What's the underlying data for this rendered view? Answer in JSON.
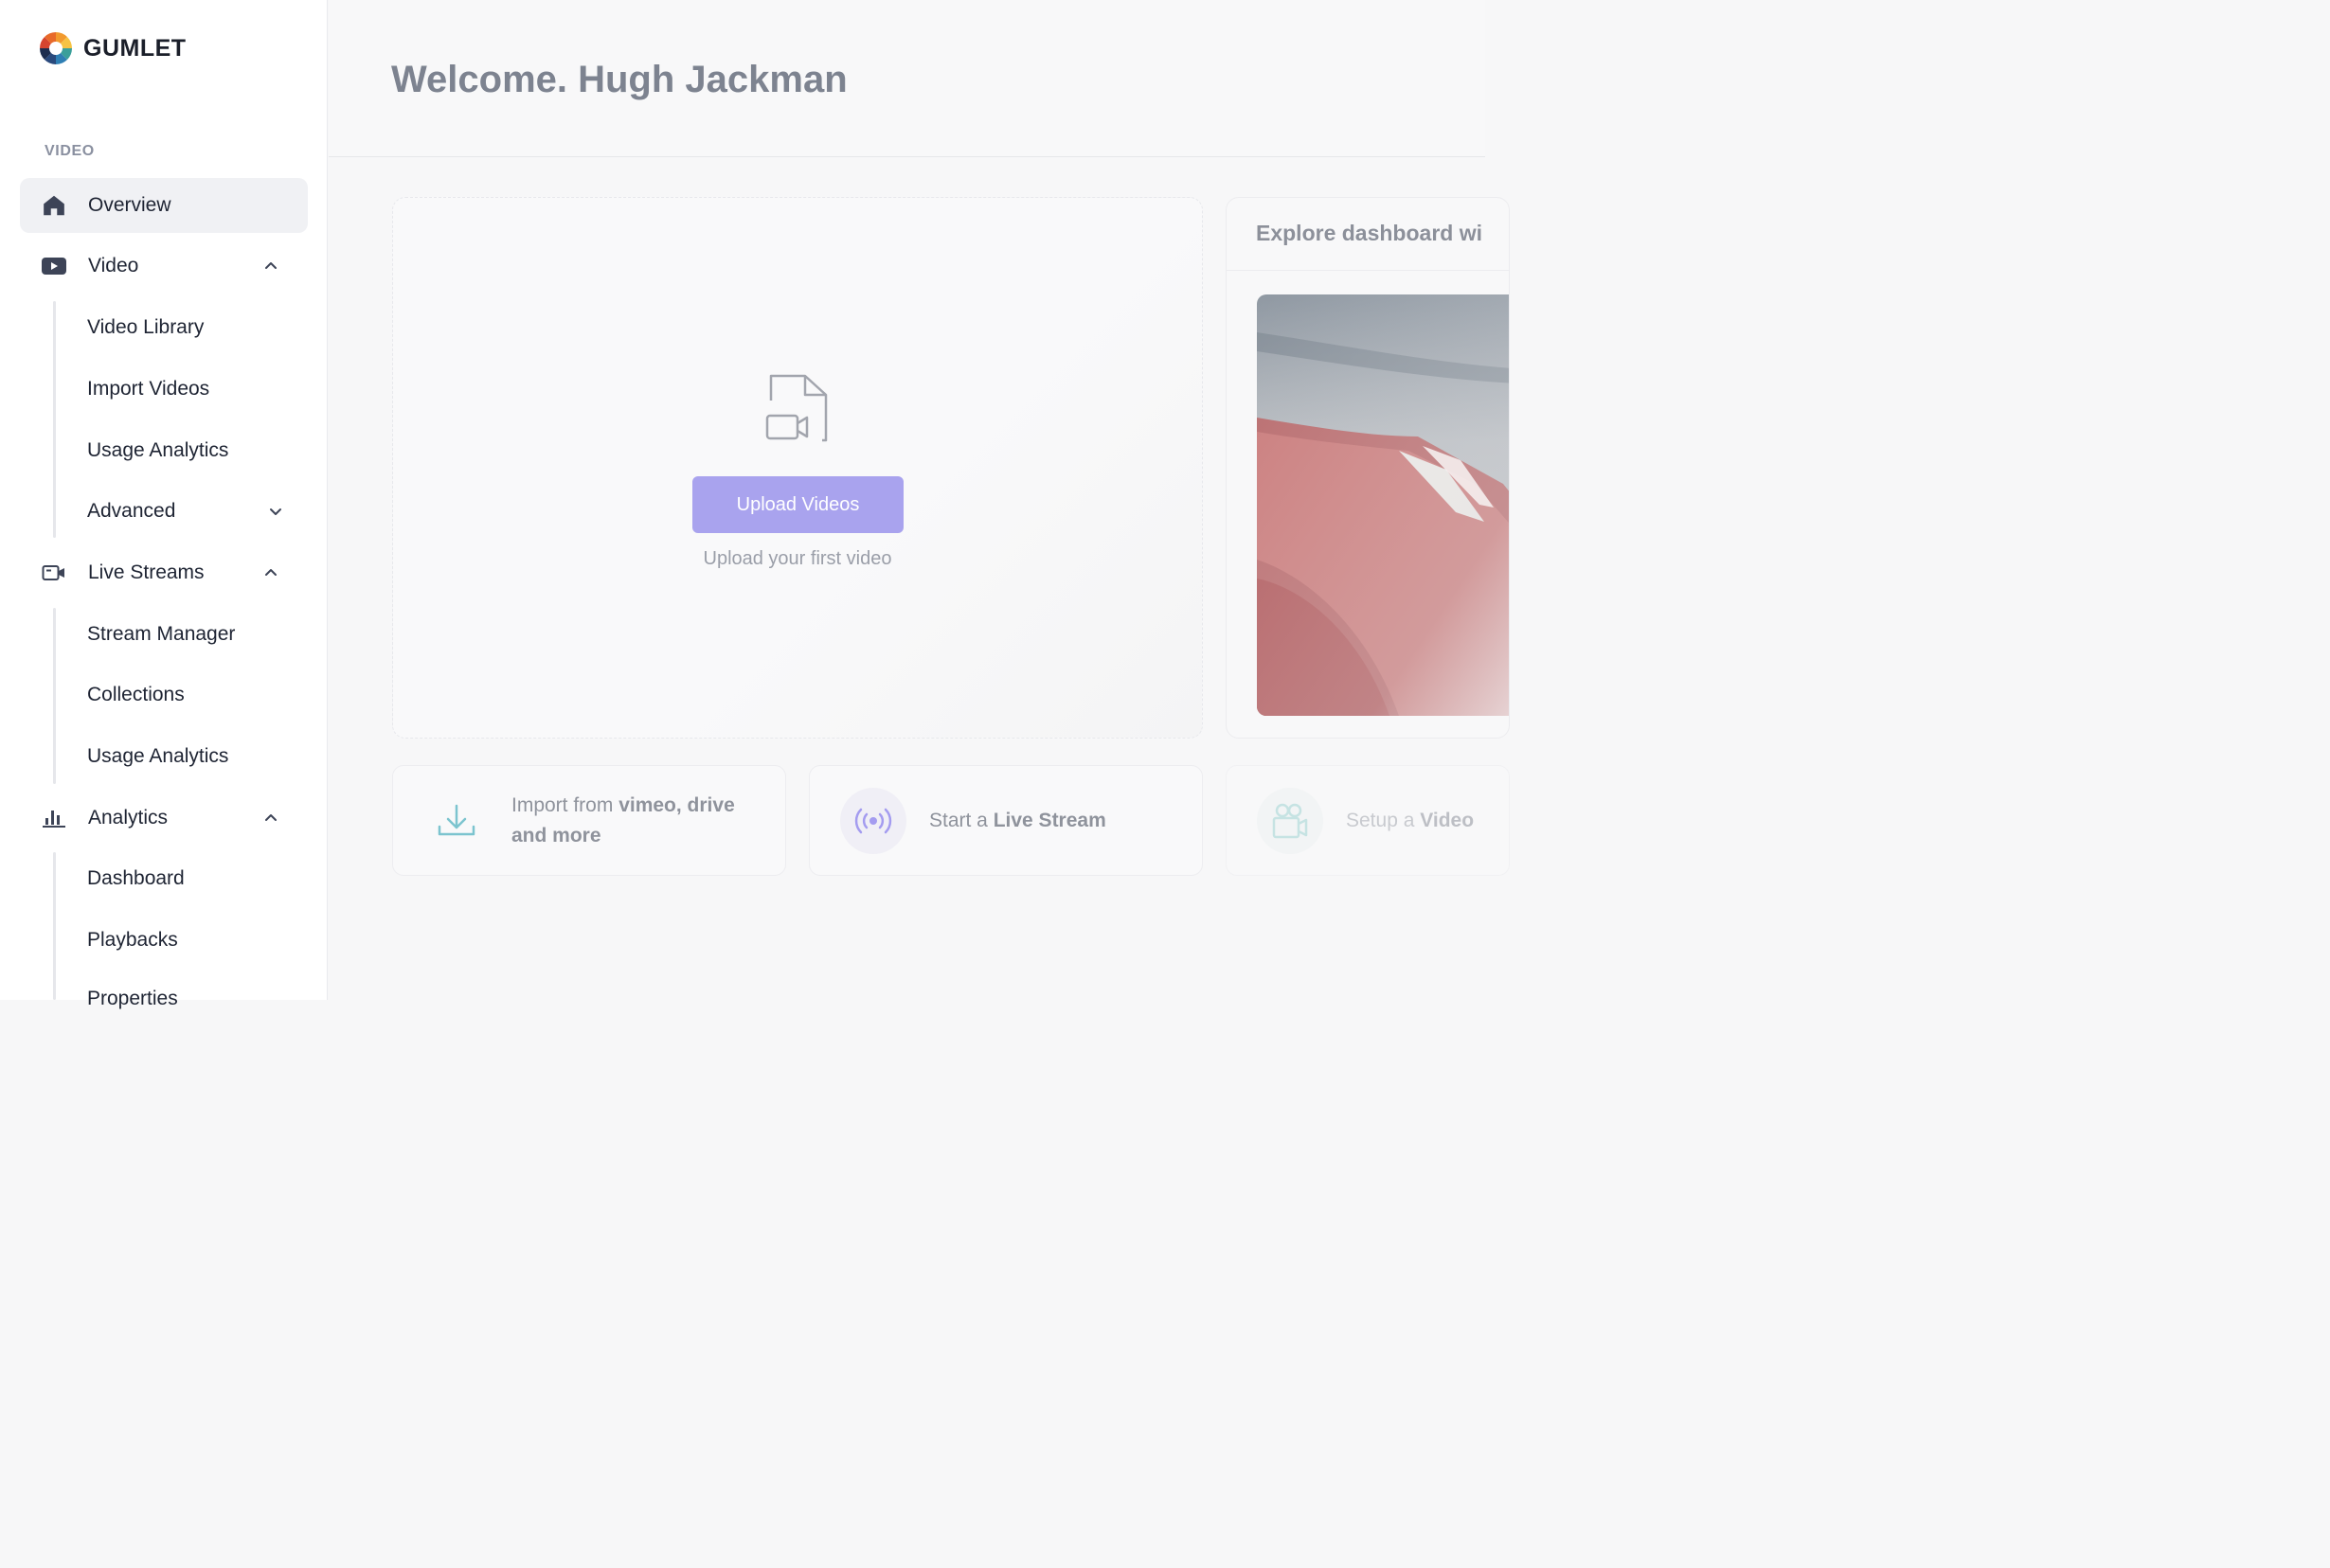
{
  "brand": {
    "name": "GUMLET"
  },
  "sidebar": {
    "section_label": "VIDEO",
    "items": [
      {
        "label": "Overview",
        "icon": "home-icon"
      },
      {
        "label": "Video",
        "icon": "youtube-icon"
      },
      {
        "label": "Live Streams",
        "icon": "video-camera-icon"
      },
      {
        "label": "Analytics",
        "icon": "bar-chart-icon"
      }
    ],
    "video_sub": [
      "Video Library",
      "Import Videos",
      "Usage Analytics",
      "Advanced"
    ],
    "live_sub": [
      "Stream Manager",
      "Collections",
      "Usage Analytics"
    ],
    "analytics_sub": [
      "Dashboard",
      "Playbacks",
      "Properties"
    ]
  },
  "header": {
    "welcome": "Welcome. Hugh Jackman"
  },
  "upload": {
    "button_label": "Upload Videos",
    "subtitle": "Upload your first video",
    "icon": "file-video-icon"
  },
  "explore": {
    "title": "Explore dashboard wi"
  },
  "tiles": {
    "import": {
      "prefix": "Import from ",
      "bold": "vimeo, drive",
      "line2": "and more",
      "icon": "download-icon"
    },
    "live": {
      "prefix": "Start a ",
      "bold": "Live Stream",
      "icon": "broadcast-icon"
    },
    "setup": {
      "prefix": "Setup a ",
      "bold": "Video",
      "icon": "movie-camera-icon"
    }
  },
  "colors": {
    "accent": "#a9a3ee",
    "text": "#1e2433",
    "muted": "#8a90a0"
  }
}
